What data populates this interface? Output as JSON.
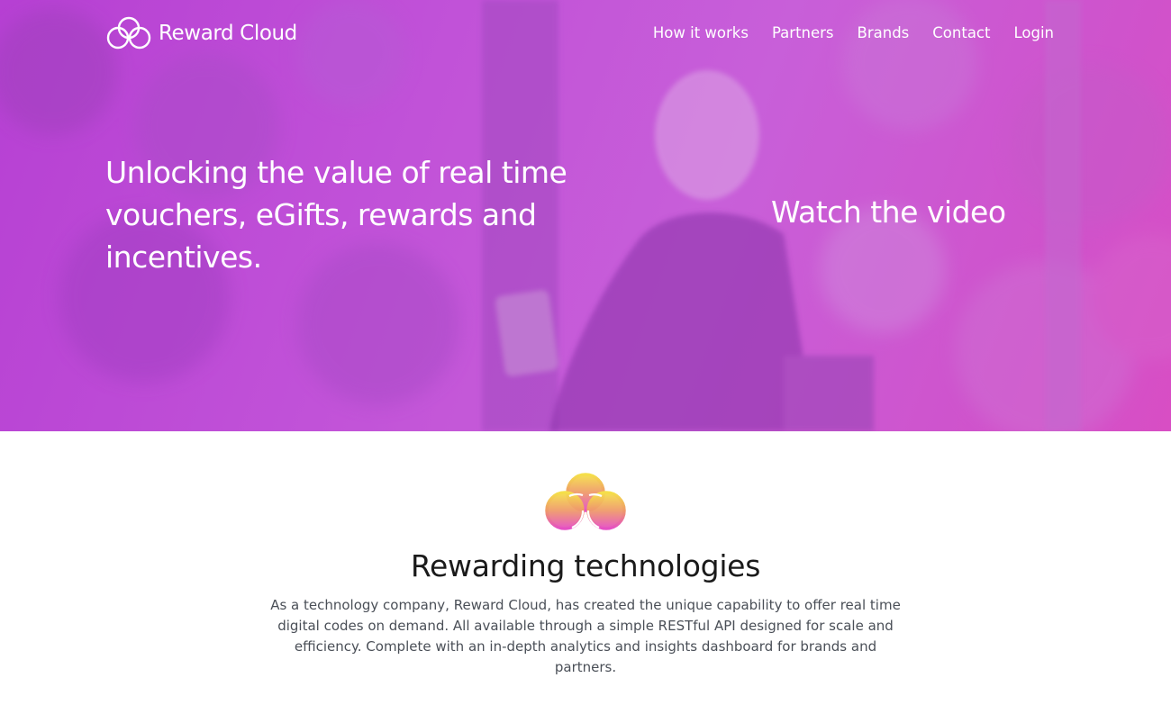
{
  "header": {
    "brand_name": "Reward Cloud",
    "nav": [
      {
        "label": "How it works"
      },
      {
        "label": "Partners"
      },
      {
        "label": "Brands"
      },
      {
        "label": "Contact"
      },
      {
        "label": "Login"
      }
    ]
  },
  "hero": {
    "headline": "Unlocking the value of real time vouchers, eGifts, rewards and incentives.",
    "video_link": "Watch the video",
    "overlay_colors": [
      "#b640d3",
      "#c85fd9",
      "#d84ec4"
    ]
  },
  "about": {
    "title": "Rewarding technologies",
    "body": "As a technology company, Reward Cloud, has created the unique capability to offer real time digital codes on demand. All available through a simple RESTful API designed for scale and efficiency. Complete with an in-depth analytics and insights dashboard for brands and partners.",
    "logo_gradient": [
      "#f5e04a",
      "#ef9a6a",
      "#e54fc4"
    ]
  },
  "icons": {
    "brand": "cloud-logo-icon",
    "about": "cloud-logo-icon"
  }
}
